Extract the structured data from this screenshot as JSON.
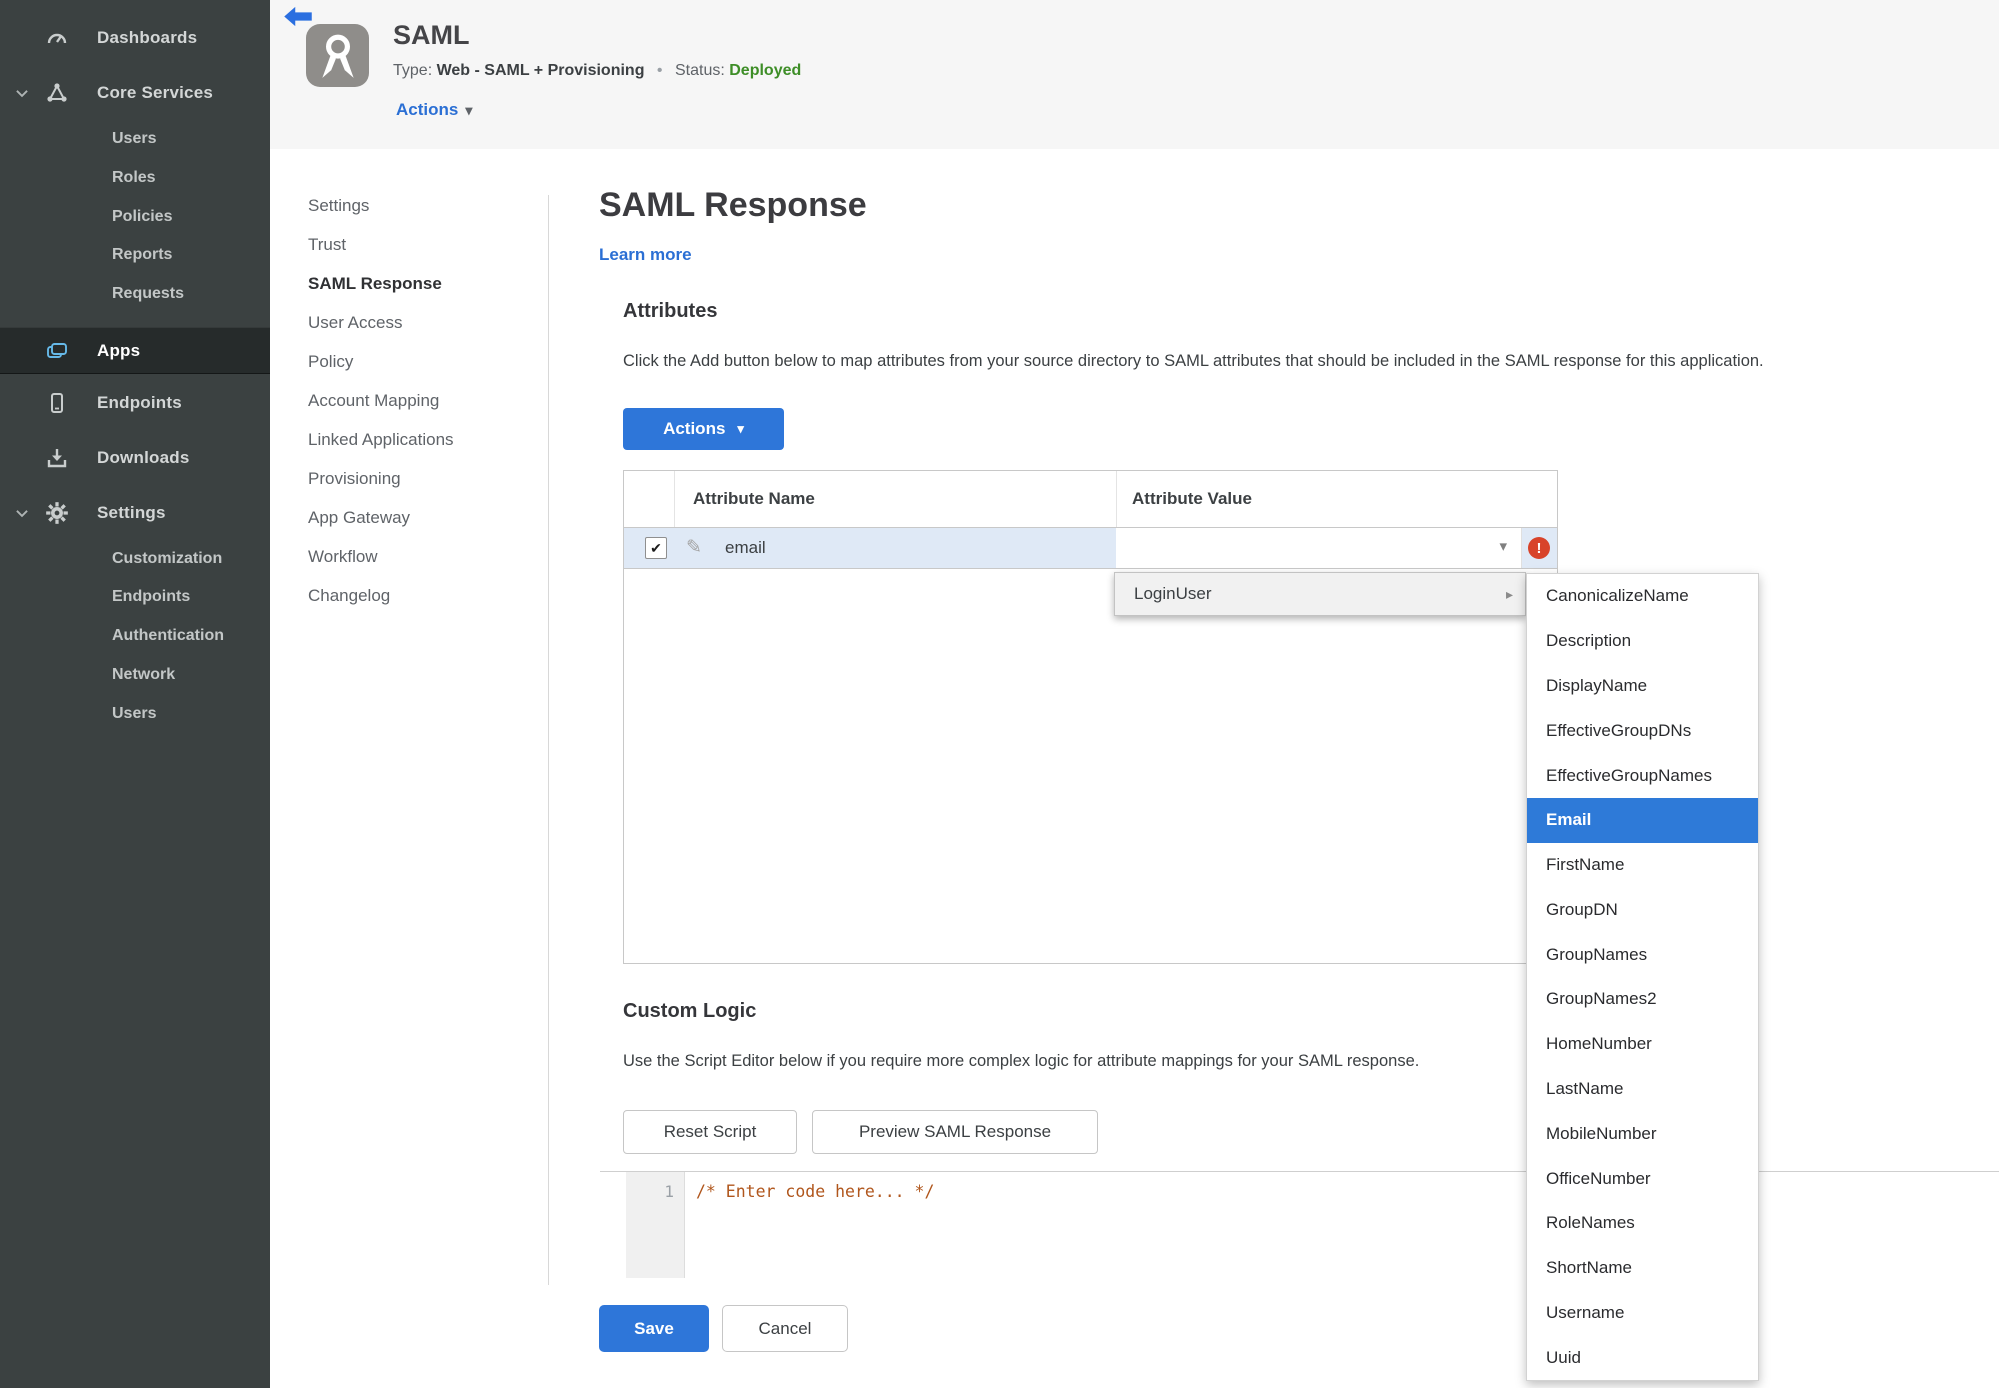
{
  "colors": {
    "accent_blue": "#2e76d9",
    "link_blue": "#2b6fd4",
    "status_green": "#3e8e27",
    "error_red": "#d8432a",
    "sidebar_bg": "#3b4141",
    "sidebar_active_bg": "#262b2b",
    "apps_icon_blue": "#66b9e8",
    "selected_row_blue": "#dfe9f6",
    "menu_selected_blue": "#2e7ad8",
    "code_orange": "#b0561c",
    "header_band": "#f6f6f6"
  },
  "icons": {
    "caret_down": "▾",
    "submenu_arrow": "▸",
    "pencil": "✎",
    "check": "✔",
    "error_mark": "!",
    "bullet": "•"
  },
  "sidebar": {
    "items": [
      {
        "label": "Dashboards"
      },
      {
        "label": "Core Services"
      },
      {
        "label": "Users"
      },
      {
        "label": "Roles"
      },
      {
        "label": "Policies"
      },
      {
        "label": "Reports"
      },
      {
        "label": "Requests"
      },
      {
        "label": "Apps"
      },
      {
        "label": "Endpoints"
      },
      {
        "label": "Downloads"
      },
      {
        "label": "Settings"
      },
      {
        "label": "Customization"
      },
      {
        "label": "Endpoints"
      },
      {
        "label": "Authentication"
      },
      {
        "label": "Network"
      },
      {
        "label": "Users"
      }
    ]
  },
  "header": {
    "title": "SAML",
    "type_label": "Type:",
    "type_value": "Web - SAML + Provisioning",
    "status_label": "Status:",
    "status_value": "Deployed",
    "actions_label": "Actions"
  },
  "subnav": {
    "items": [
      "Settings",
      "Trust",
      "SAML Response",
      "User Access",
      "Policy",
      "Account Mapping",
      "Linked Applications",
      "Provisioning",
      "App Gateway",
      "Workflow",
      "Changelog"
    ],
    "active": "SAML Response"
  },
  "main": {
    "heading": "SAML Response",
    "learn_more": "Learn more",
    "attributes": {
      "title": "Attributes",
      "description": "Click the Add button below to map attributes from your source directory to SAML attributes that should be included in the SAML response for this application.",
      "actions_button": "Actions"
    },
    "table": {
      "columns": [
        "Attribute Name",
        "Attribute Value"
      ],
      "row": {
        "name": "email",
        "value": ""
      }
    },
    "value_menu": {
      "trigger": "LoginUser",
      "selected": "Email",
      "items": [
        "CanonicalizeName",
        "Description",
        "DisplayName",
        "EffectiveGroupDNs",
        "EffectiveGroupNames",
        "Email",
        "FirstName",
        "GroupDN",
        "GroupNames",
        "GroupNames2",
        "HomeNumber",
        "LastName",
        "MobileNumber",
        "OfficeNumber",
        "RoleNames",
        "ShortName",
        "Username",
        "Uuid"
      ]
    },
    "custom_logic": {
      "title": "Custom Logic",
      "description": "Use the Script Editor below if you require more complex logic for attribute mappings for your SAML response.",
      "reset_button": "Reset Script",
      "preview_button": "Preview SAML Response",
      "editor": {
        "line_number": "1",
        "code": "/* Enter code here... */"
      }
    },
    "footer": {
      "save": "Save",
      "cancel": "Cancel"
    }
  }
}
